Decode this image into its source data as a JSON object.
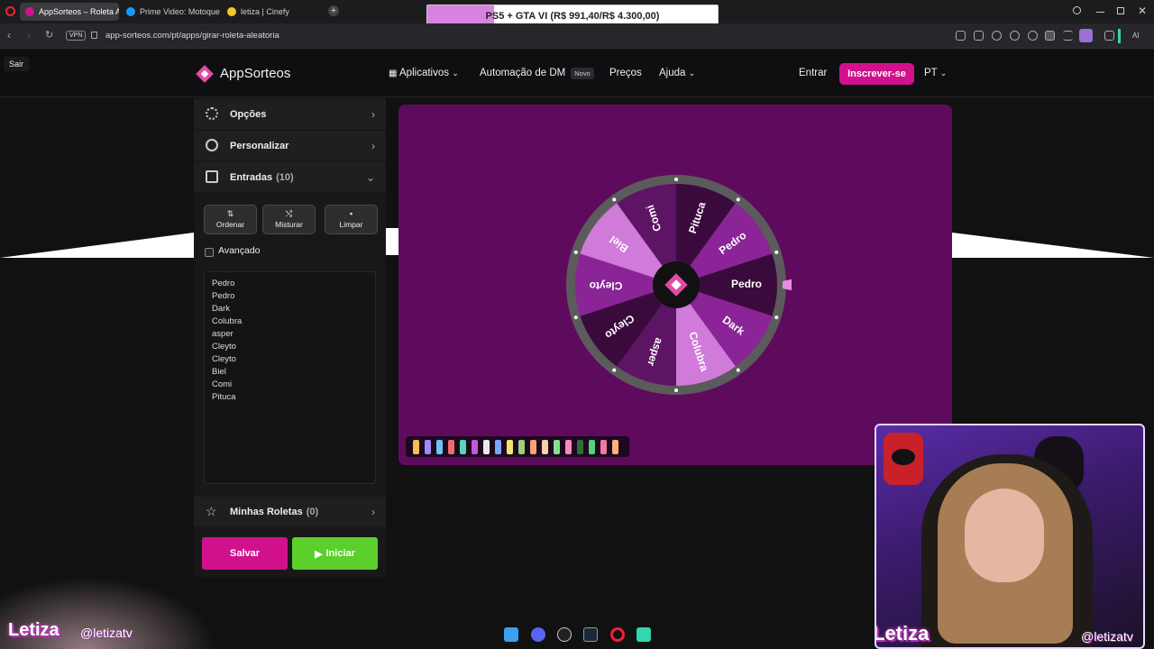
{
  "browser": {
    "tabs": [
      {
        "title": "AppSorteos – Roleta Aleat",
        "active": true
      },
      {
        "title": "Prime Video: Motoqueiro",
        "active": false
      },
      {
        "title": "letiza | Cinefy",
        "active": false
      }
    ],
    "new_tab_glyph": "+",
    "promo_banner": {
      "text": "PS5 + GTA VI (R$ 991,40/R$ 4.300,00)",
      "progress": 0.2306
    },
    "vpn_label": "VPN",
    "url": "app-sorteos.com/pt/apps/girar-roleta-aleatoria",
    "ai_label": "AI"
  },
  "tooltip": {
    "sair": "Sair"
  },
  "header": {
    "logo": "AppSorteos",
    "nav": {
      "apps": "Aplicativos",
      "dm": "Automação de DM",
      "dm_badge": "Novo",
      "prices": "Preços",
      "help": "Ajuda"
    },
    "login": "Entrar",
    "signup": "Inscrever-se",
    "lang": "PT"
  },
  "panel": {
    "options": "Opções",
    "customize": "Personalizar",
    "entries": "Entradas",
    "entries_count": "(10)",
    "sort": "Ordenar",
    "shuffle": "Misturar",
    "clear": "Limpar",
    "advanced": "Avançado",
    "entries_list": [
      "Pedro",
      "Pedro",
      "Dark",
      "Colubra",
      "asper",
      "Cleyto",
      "Cleyto",
      "Biel",
      "Comi",
      "Pituca"
    ],
    "my_wheels": "Minhas Roletas",
    "my_wheels_count": "(0)",
    "save": "Salvar",
    "start": "Iniciar"
  },
  "wheel": {
    "labels": [
      "Pedro",
      "Dark",
      "Colubra",
      "asper",
      "Cleyto",
      "Cleyto",
      "Biel",
      "Comi",
      "Pituca",
      "Pedro"
    ],
    "colors": [
      "#3b0a3c",
      "#8a2497",
      "#d07ad9",
      "#5d1464",
      "#3b0a3c",
      "#8a2497",
      "#d07ad9",
      "#5d1464",
      "#3b0a3c",
      "#8a2497"
    ],
    "rim_color": "#5b5b5b",
    "pointer_color": "#e58ce0"
  },
  "palette_colors": [
    "#f2c14e",
    "#9b8bf4",
    "#6ec3f0",
    "#ef6b6b",
    "#56d6b7",
    "#c45ad9",
    "#e9e9e9",
    "#7aa6f7",
    "#f2e46c",
    "#9ad07a",
    "#f7a07a",
    "#f4d2a8",
    "#83e08c",
    "#f78bb6",
    "#2f6e3a",
    "#56d07a",
    "#f07aa6",
    "#ffb07a"
  ],
  "webcam": {
    "name": "Letiza",
    "handle": "@letizatv"
  },
  "overlay": {
    "name": "Letiza",
    "handle": "@letizatv"
  },
  "taskbar_icons": [
    "windows-icon",
    "discord-icon",
    "obs-icon",
    "steam-icon",
    "opera-icon",
    "app-icon"
  ]
}
